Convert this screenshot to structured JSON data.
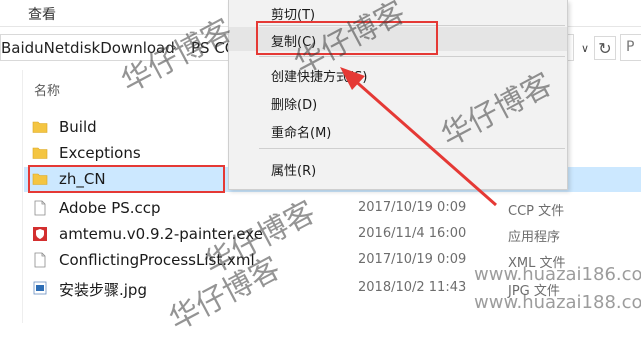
{
  "ribbon": {
    "tab_view": "查看"
  },
  "address": {
    "crumb1": "BaiduNetdiskDownload",
    "separator": "›",
    "crumb2": "PS CC",
    "refresh_glyph": "↻",
    "dropdown_glyph": "∨",
    "search_glyph": "P"
  },
  "list": {
    "column_name": "名称",
    "items": [
      {
        "name": "Build",
        "date": "",
        "type": "",
        "icon": "folder-icon"
      },
      {
        "name": "Exceptions",
        "date": "",
        "type": "",
        "icon": "folder-icon"
      },
      {
        "name": "zh_CN",
        "date": "",
        "type": "",
        "icon": "folder-icon"
      },
      {
        "name": "Adobe PS.ccp",
        "date": "2017/10/19 0:09",
        "type": "CCP 文件",
        "icon": "file-icon"
      },
      {
        "name": "amtemu.v0.9.2-painter.exe",
        "date": "2016/11/4 16:00",
        "type": "应用程序",
        "icon": "app-shield-icon"
      },
      {
        "name": "ConflictingProcessList.xml",
        "date": "2017/10/19 0:09",
        "type": "XML 文件",
        "icon": "file-icon"
      },
      {
        "name": "安装步骤.jpg",
        "date": "2018/10/2 11:43",
        "type": "JPG 文件",
        "icon": "image-file-icon"
      }
    ]
  },
  "context_menu": {
    "cut": "剪切(T)",
    "copy": "复制(C)",
    "shortcut": "创建快捷方式(S)",
    "delete": "删除(D)",
    "rename": "重命名(M)",
    "properties": "属性(R)"
  },
  "watermarks": {
    "text": "华仔博客",
    "url1": "www.huazai186.com",
    "url2": "www.huazai188.com"
  },
  "colors": {
    "selection": "#cce8ff",
    "highlight_box": "#e53935",
    "folder": "#f4c542",
    "menu_bg": "#f2f2f2"
  }
}
